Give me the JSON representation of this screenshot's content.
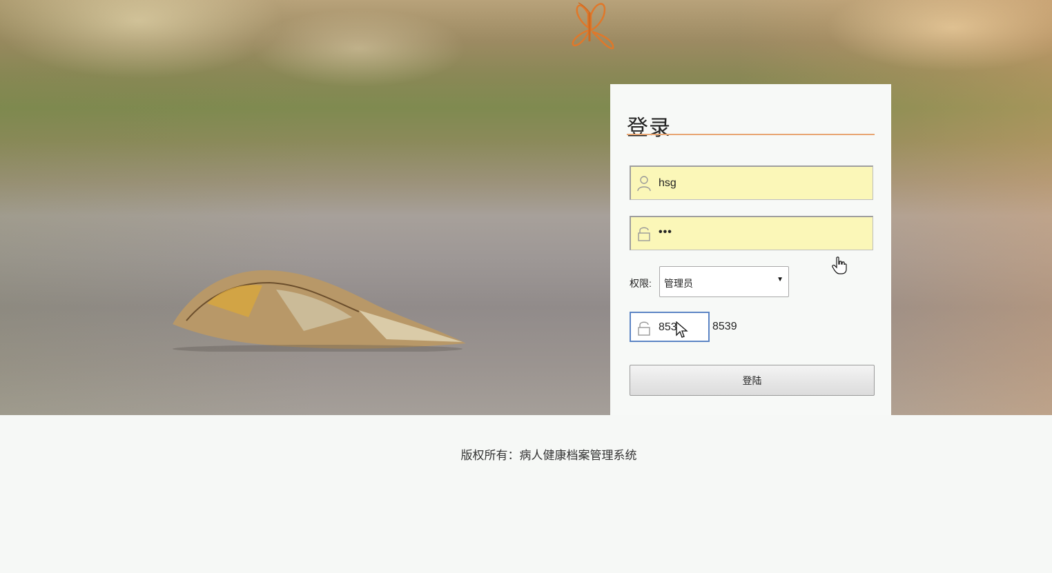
{
  "login": {
    "title": "登录",
    "username_value": "hsg",
    "password_value": "•••",
    "role_label": "权限:",
    "role_selected": "管理员",
    "captcha_input_value": "853",
    "captcha_code": "8539",
    "submit_label": "登陆"
  },
  "footer": {
    "copyright": "版权所有：病人健康档案管理系统"
  },
  "colors": {
    "field_autofill_bg": "#fbf7b8",
    "title_underline": "#e8a672",
    "captcha_focus_border": "#5b84c4"
  },
  "icons": {
    "username": "user-icon",
    "password": "lock-icon",
    "captcha": "lock-icon",
    "role_dropdown": "caret-down-icon"
  }
}
